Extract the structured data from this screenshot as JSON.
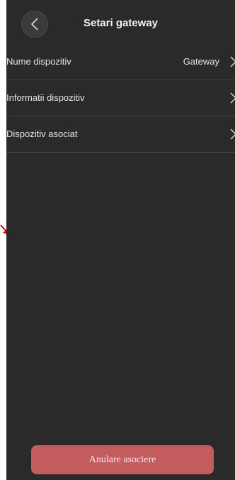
{
  "header": {
    "title": "Setari gateway"
  },
  "settings": {
    "items": [
      {
        "label": "Nume dispozitiv",
        "value": "Gateway"
      },
      {
        "label": "Informatii dispozitiv",
        "value": ""
      },
      {
        "label": "Dispozitiv asociat",
        "value": ""
      }
    ]
  },
  "footer": {
    "unbind_label": "Anulare asociere"
  },
  "colors": {
    "background": "#2a2a2a",
    "accent_button": "#c35c5e",
    "annotation_arrow": "#e00000"
  },
  "icons": {
    "back": "chevron-left-icon",
    "row_chevron": "chevron-right-icon",
    "annotation": "red-arrow-icon"
  }
}
